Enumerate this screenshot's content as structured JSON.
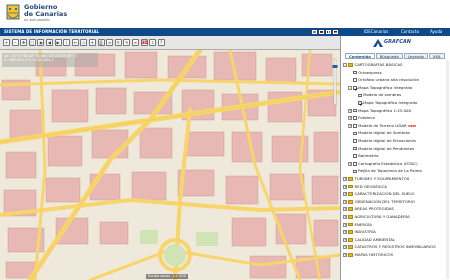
{
  "header": {
    "logo_line1": "Gobierno",
    "logo_line2": "de Canarias",
    "logo_tagline": "un solo pueblo",
    "nav_title": "SISTEMA DE INFORMACIÓN TERRITORIAL",
    "links": [
      "IDECanarias",
      "Contacto",
      "Ayuda"
    ]
  },
  "map": {
    "coords_line1": "lat: 28°07'30,82\" N, lon: 15°25'23,08\" O",
    "coords_line2": "X: 458.632,2   Y: 3.110.624,7",
    "scale_text": "Escala aprox. 1:1.500"
  },
  "panel": {
    "brand": "GRAFCAN",
    "tabs": [
      "Contenido",
      "Búsqueda",
      "Leyenda",
      "XML"
    ],
    "tree": [
      {
        "label": "CARTOGRAFÍAS BÁSICAS",
        "level": 0,
        "type": "folder",
        "expander": "-"
      },
      {
        "label": "Ortoexpress",
        "level": 1,
        "type": "check",
        "checked": false
      },
      {
        "label": "Ortofoto urbana alta resolución",
        "level": 1,
        "type": "check",
        "checked": false
      },
      {
        "label": "Mapa Topográfico Integrado",
        "level": 1,
        "type": "check",
        "checked": true,
        "expander": "-"
      },
      {
        "label": "Modelo de sombras",
        "level": 2,
        "type": "check",
        "checked": false
      },
      {
        "label": "Mapa Topográfico Integrado",
        "level": 2,
        "type": "check",
        "checked": true
      },
      {
        "label": "Mapa Topográfico 1:25.000",
        "level": 1,
        "type": "check",
        "checked": false,
        "expander": "+"
      },
      {
        "label": "Fototeca",
        "level": 1,
        "type": "check",
        "checked": false,
        "expander": "+"
      },
      {
        "label": "Modelo de Terreno LIDAR",
        "level": 1,
        "type": "check",
        "checked": false,
        "expander": "+",
        "badge": "NEW"
      },
      {
        "label": "Modelo digital de Sombras",
        "level": 1,
        "type": "check",
        "checked": false
      },
      {
        "label": "Modelo digital de Elevaciones",
        "level": 1,
        "type": "check",
        "checked": false
      },
      {
        "label": "Modelo digital de Pendientes",
        "level": 1,
        "type": "check",
        "checked": false
      },
      {
        "label": "Batimetría",
        "level": 1,
        "type": "check",
        "checked": false
      },
      {
        "label": "Cartografía Estadística (ISTAC)",
        "level": 1,
        "type": "check",
        "checked": false,
        "expander": "+"
      },
      {
        "label": "Rejilla de Toponimia de La Palma",
        "level": 1,
        "type": "check",
        "checked": false
      },
      {
        "label": "TURISMO Y EQUIPAMIENTOS",
        "level": 0,
        "type": "folder",
        "expander": "+"
      },
      {
        "label": "RED GEODÉSICA",
        "level": 0,
        "type": "folder",
        "expander": "+"
      },
      {
        "label": "CARACTERIZACIÓN DEL SUELO",
        "level": 0,
        "type": "folder",
        "expander": "+"
      },
      {
        "label": "ORDENACIÓN DEL TERRITORIO",
        "level": 0,
        "type": "folder",
        "expander": "+"
      },
      {
        "label": "ÁREAS PROTEGIDAS",
        "level": 0,
        "type": "folder",
        "expander": "+"
      },
      {
        "label": "AGRICULTURA Y GANADERÍA",
        "level": 0,
        "type": "folder",
        "expander": "+"
      },
      {
        "label": "ENERGÍA",
        "level": 0,
        "type": "folder",
        "expander": "+"
      },
      {
        "label": "INDUSTRIA",
        "level": 0,
        "type": "folder",
        "expander": "+"
      },
      {
        "label": "CALIDAD AMBIENTAL",
        "level": 0,
        "type": "folder",
        "expander": "+"
      },
      {
        "label": "CATASTROS Y REGISTROS INMOBILIARIOS",
        "level": 0,
        "type": "folder",
        "expander": "+"
      },
      {
        "label": "MAPAS HISTÓRICOS",
        "level": 0,
        "type": "folder",
        "expander": "+"
      }
    ]
  },
  "colors": {
    "nav": "#0e4a8a",
    "road": "#f7d56b",
    "building": "#e7b8b4",
    "block": "#efe9db"
  }
}
